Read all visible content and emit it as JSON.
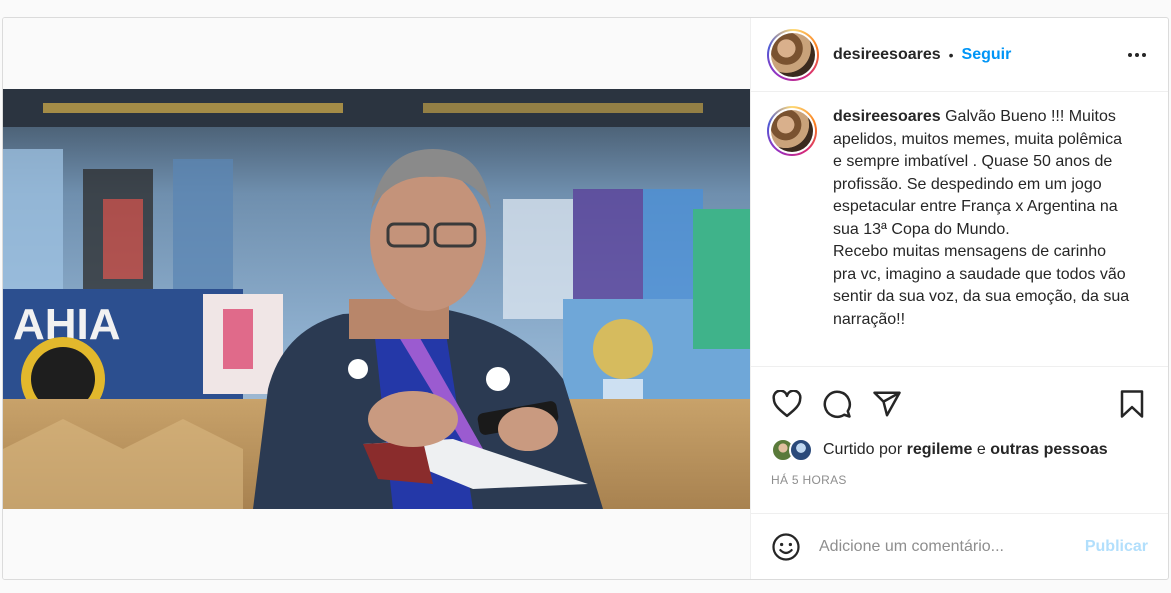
{
  "post": {
    "username": "desireesoares",
    "dot": "•",
    "follow_label": "Seguir",
    "more_icon": "more-options-icon",
    "caption_text": "Galvão Bueno !!! Muitos apelidos, muitos memes, muita polêmica e sempre imbatível . Quase 50 anos de profissão. Se despedindo em um jogo espetacular entre França x Argentina na sua 13ª Copa do Mundo.\nRecebo muitas mensagens de carinho pra vc, imagino a saudade que todos vão sentir da sua voz, da sua emoção, da sua narração!!",
    "likes": {
      "prefix": "Curtido por",
      "user": "regileme",
      "conj": "e",
      "others": "outras pessoas"
    },
    "timestamp": "HÁ 5 HORAS",
    "comment": {
      "placeholder": "Adicione um comentário...",
      "publish_label": "Publicar"
    },
    "icons": [
      "heart-icon",
      "comment-icon",
      "share-icon",
      "bookmark-icon",
      "emoji-icon"
    ],
    "colors": {
      "accent": "#0095f6",
      "publish_disabled": "#b2dffc",
      "muted": "#8e8e8e"
    }
  }
}
